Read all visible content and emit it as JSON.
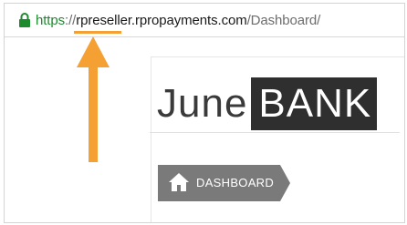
{
  "browser": {
    "url": {
      "scheme": "https",
      "separator": "://",
      "host": "rpreseller.rpropayments.com",
      "path": "/Dashboard/"
    },
    "secure_icon": "lock-icon",
    "scheme_color": "#1e8a2e"
  },
  "annotation": {
    "highlight_color": "#f5a033",
    "arrow_icon": "arrow-up-icon"
  },
  "logo": {
    "part1": "June",
    "part2": "BANK"
  },
  "nav": {
    "dashboard_label": "DASHBOARD",
    "dashboard_icon": "home-icon",
    "button_color": "#7a7a7a"
  }
}
